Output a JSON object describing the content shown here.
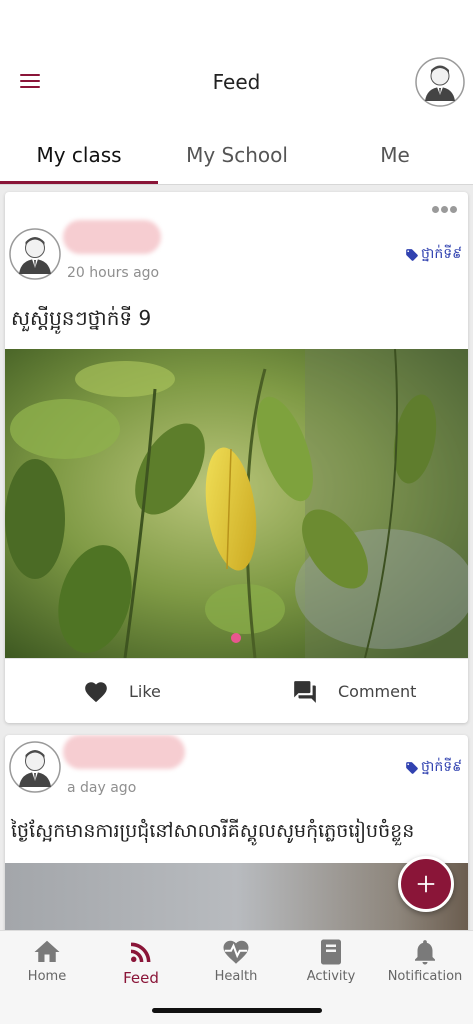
{
  "header": {
    "title": "Feed"
  },
  "tabs": [
    {
      "label": "My class",
      "active": true
    },
    {
      "label": "My School",
      "active": false
    },
    {
      "label": "Me",
      "active": false
    }
  ],
  "posts": [
    {
      "time": "20 hours ago",
      "tag": "ថ្នាក់ទី៩",
      "text": "សួស្ដីប្អូនៗថ្នាក់ទី 9",
      "like_label": "Like",
      "comment_label": "Comment"
    },
    {
      "time": "a day ago",
      "tag": "ថ្នាក់ទី៩",
      "text": "ថ្ងៃស្អែកមានការប្រជុំនៅសាលារីគីស្គូលសូមកុំភ្លេចរៀបចំខ្លួន"
    }
  ],
  "fab": {
    "icon": "plus-icon"
  },
  "bottom_nav": [
    {
      "label": "Home",
      "icon": "home-icon"
    },
    {
      "label": "Feed",
      "icon": "rss-feed-icon",
      "active": true
    },
    {
      "label": "Health",
      "icon": "heart-pulse-icon"
    },
    {
      "label": "Activity",
      "icon": "book-icon"
    },
    {
      "label": "Notification",
      "icon": "bell-icon"
    }
  ],
  "colors": {
    "accent": "#8a1538",
    "tag": "#3142b0"
  }
}
